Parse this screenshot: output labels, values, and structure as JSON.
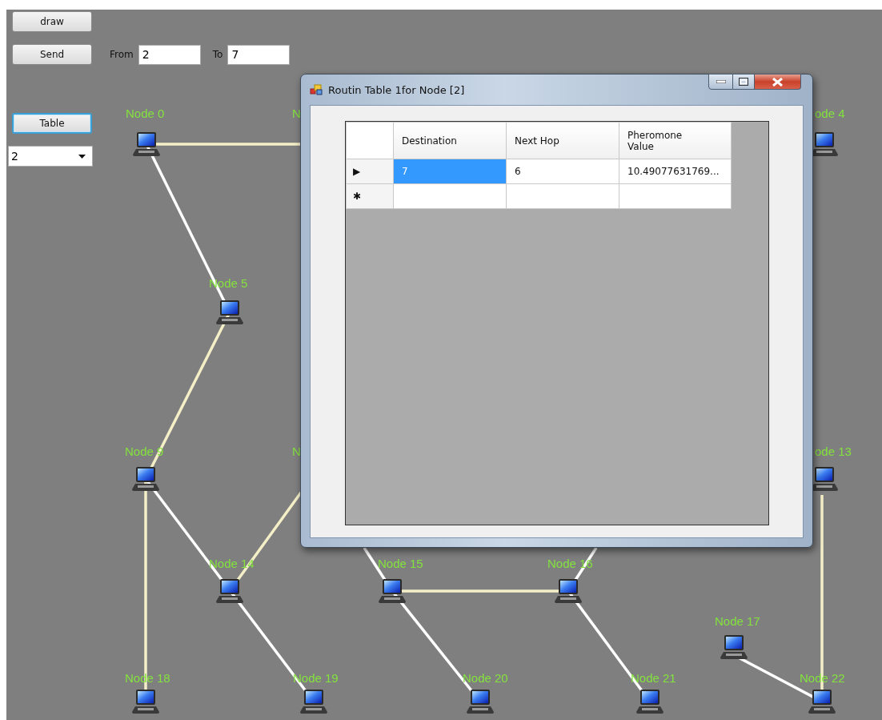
{
  "controls": {
    "draw_button": "draw",
    "send_button": "Send",
    "from_label": "From",
    "from_value": "2",
    "to_label": "To",
    "to_value": "7",
    "table_button": "Table",
    "node_select": "2"
  },
  "nodes": [
    {
      "label": "Node 0"
    },
    {
      "label": "N"
    },
    {
      "label": "ode 4"
    },
    {
      "label": "Node 5"
    },
    {
      "label": "Node 9"
    },
    {
      "label": "N"
    },
    {
      "label": "ode 13"
    },
    {
      "label": "Node 14"
    },
    {
      "label": "Node 15"
    },
    {
      "label": "Node 16"
    },
    {
      "label": "Node 17"
    },
    {
      "label": "Node 18"
    },
    {
      "label": "Node 19"
    },
    {
      "label": "Node 20"
    },
    {
      "label": "Node 21"
    },
    {
      "label": "Node 22"
    }
  ],
  "dialog": {
    "title": "Routin Table 1for Node [2]",
    "columns": [
      "Destination",
      "Next Hop",
      "Pheromone Value"
    ],
    "rows": [
      {
        "marker": "▶",
        "cells": [
          {
            "text": "7",
            "selected": true
          },
          {
            "text": "6",
            "selected": false
          },
          {
            "text": "10.49077631769...",
            "selected": false
          }
        ]
      }
    ],
    "new_row": {
      "marker": "✱"
    }
  }
}
